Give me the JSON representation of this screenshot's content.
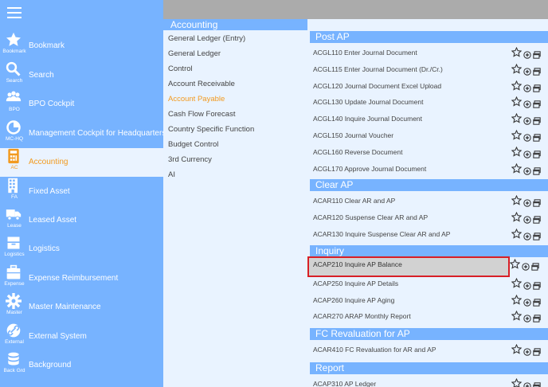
{
  "sidebar": {
    "items": [
      {
        "label": "Bookmark",
        "code": "Bookmark",
        "icon": "star-icon"
      },
      {
        "label": "Search",
        "code": "Search",
        "icon": "search-icon"
      },
      {
        "label": "BPO Cockpit",
        "code": "BPO",
        "icon": "people-icon"
      },
      {
        "label": "Management Cockpit for Headquarters",
        "code": "MC-HQ",
        "icon": "chart-icon"
      },
      {
        "label": "Accounting",
        "code": "AC",
        "icon": "calculator-icon"
      },
      {
        "label": "Fixed Asset",
        "code": "FA",
        "icon": "building-icon"
      },
      {
        "label": "Leased Asset",
        "code": "Lease",
        "icon": "truck-icon"
      },
      {
        "label": "Logistics",
        "code": "Logistics",
        "icon": "box-icon"
      },
      {
        "label": "Expense Reimbursement",
        "code": "Expense",
        "icon": "briefcase-icon"
      },
      {
        "label": "Master Maintenance",
        "code": "Master",
        "icon": "gear-icon"
      },
      {
        "label": "External System",
        "code": "External",
        "icon": "link-icon"
      },
      {
        "label": "Background",
        "code": "Back Grd",
        "icon": "database-icon"
      }
    ]
  },
  "submenu": {
    "title": "Accounting",
    "items": [
      "General Ledger (Entry)",
      "General Ledger",
      "Control",
      "Account Receivable",
      "Account Payable",
      "Cash Flow Forecast",
      "Country Specific Function",
      "Budget Control",
      "3rd Currency",
      "AI"
    ]
  },
  "sections": [
    {
      "title": "Post AP",
      "rows": [
        "ACGL110 Enter Journal Document",
        "ACGL115 Enter Journal Document (Dr./Cr.)",
        "ACGL120 Journal Document Excel Upload",
        "ACGL130 Update Journal Document",
        "ACGL140 Inquire Journal Document",
        "ACGL150 Journal Voucher",
        "ACGL160 Reverse Document",
        "ACGL170 Approve Journal Document"
      ]
    },
    {
      "title": "Clear AP",
      "rows": [
        "ACAR110 Clear AR and AP",
        "ACAR120 Suspense Clear AR and AP",
        "ACAR130 Inquire Suspense Clear AR and AP"
      ]
    },
    {
      "title": "Inquiry",
      "rows": [
        "ACAP210 Inquire AP Balance",
        "ACAP250 Inquire AP Details",
        "ACAP260 Inquire AP Aging",
        "ACAR270 ARAP Monthly Report"
      ]
    },
    {
      "title": "FC Revaluation for AP",
      "rows": [
        "ACAR410 FC Revaluation for AR and AP"
      ]
    },
    {
      "title": "Report",
      "rows": [
        "ACAP310 AP Ledger"
      ]
    }
  ],
  "colors": {
    "accent": "#f29a1f",
    "sidebar": "#77b3ff",
    "highlight_border": "#d81f26"
  }
}
